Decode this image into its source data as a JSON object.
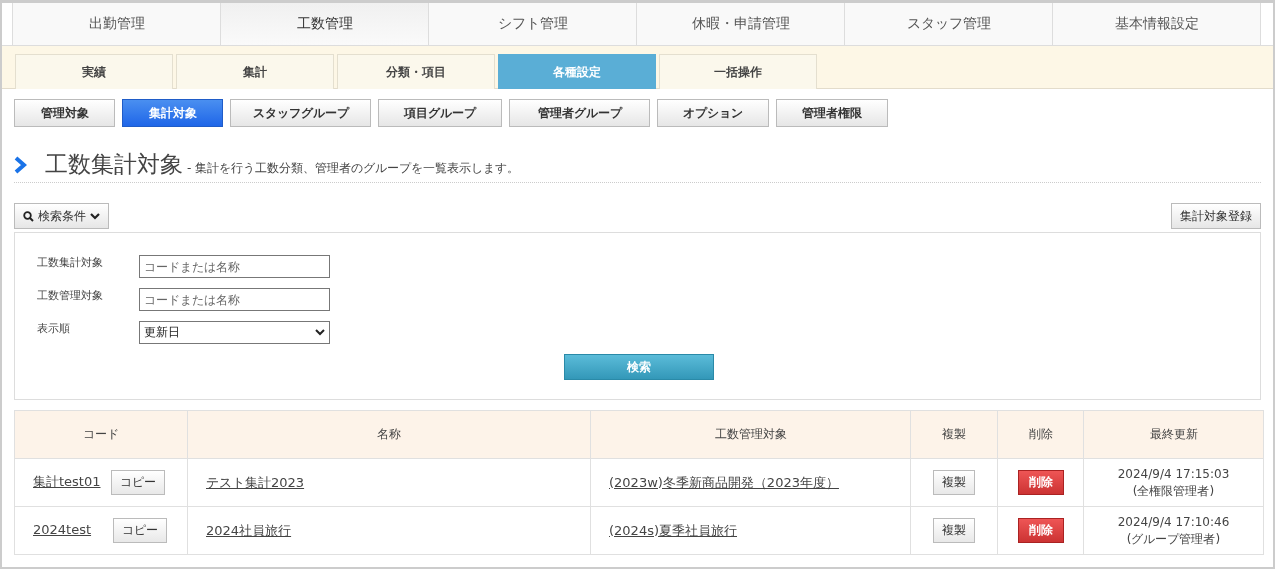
{
  "main_tabs": [
    {
      "label": "出勤管理",
      "selected": false
    },
    {
      "label": "工数管理",
      "selected": true
    },
    {
      "label": "シフト管理",
      "selected": false
    },
    {
      "label": "休暇・申請管理",
      "selected": false
    },
    {
      "label": "スタッフ管理",
      "selected": false
    },
    {
      "label": "基本情報設定",
      "selected": false
    }
  ],
  "sub_tabs": [
    {
      "label": "実績",
      "selected": false
    },
    {
      "label": "集計",
      "selected": false
    },
    {
      "label": "分類・項目",
      "selected": false
    },
    {
      "label": "各種設定",
      "selected": true
    },
    {
      "label": "一括操作",
      "selected": false
    }
  ],
  "setting_buttons": [
    {
      "label": "管理対象",
      "selected": false
    },
    {
      "label": "集計対象",
      "selected": true
    },
    {
      "label": "スタッフグループ",
      "selected": false
    },
    {
      "label": "項目グループ",
      "selected": false
    },
    {
      "label": "管理者グループ",
      "selected": false
    },
    {
      "label": "オプション",
      "selected": false
    },
    {
      "label": "管理者権限",
      "selected": false
    }
  ],
  "page_title": "工数集計対象",
  "page_description": "- 集計を行う工数分類、管理者のグループを一覧表示します。",
  "search_toggle": {
    "label": "検索条件",
    "expanded": true
  },
  "register_button": "集計対象登録",
  "search_fields": [
    {
      "kind": "text",
      "label": "工数集計対象",
      "placeholder": "コードまたは名称"
    },
    {
      "kind": "text",
      "label": "工数管理対象",
      "placeholder": "コードまたは名称"
    },
    {
      "kind": "select",
      "label": "表示順",
      "value": "更新日"
    }
  ],
  "search_button": "検索",
  "table": {
    "columns": [
      "コード",
      "名称",
      "工数管理対象",
      "複製",
      "削除",
      "最終更新"
    ],
    "rows": [
      {
        "code": "集計test01",
        "copy": "コピー",
        "name": "テスト集計2023",
        "target": "(2023w)冬季新商品開発（2023年度）",
        "duplicate": "複製",
        "delete": "削除",
        "updated": "2024/9/4 17:15:03",
        "updated_by": "(全権限管理者)"
      },
      {
        "code": "2024test",
        "copy": "コピー",
        "name": "2024社員旅行",
        "target": "(2024s)夏季社員旅行",
        "duplicate": "複製",
        "delete": "削除",
        "updated": "2024/9/4 17:10:46",
        "updated_by": "(グループ管理者)"
      }
    ]
  }
}
